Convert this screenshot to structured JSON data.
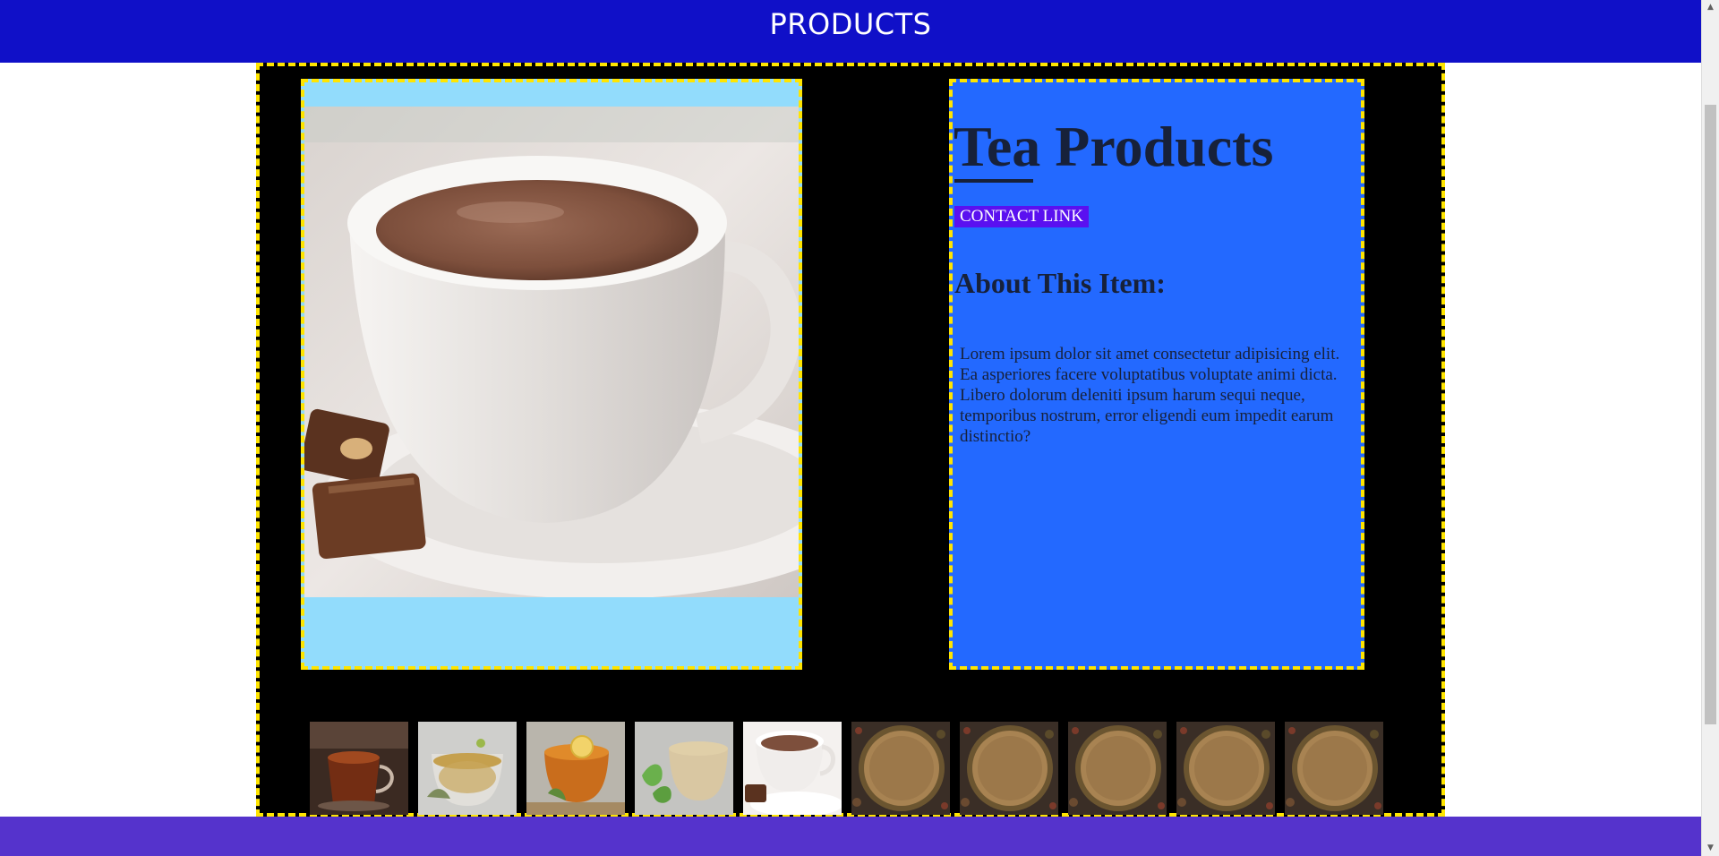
{
  "header": {
    "title": "PRODUCTS"
  },
  "product": {
    "title": "Tea Products",
    "contact_link": "CONTACT LINK",
    "about_heading": "About This Item:",
    "description": "Lorem ipsum dolor sit amet consectetur adipisicing elit. Ea asperiores facere voluptatibus voluptate animi dicta. Libero dolorum deleniti ipsum harum sequi neque, temporibus nostrum, error eligendi eum impedit earum distinctio?"
  },
  "thumbnails": [
    {
      "icon": "black-tea-icon"
    },
    {
      "icon": "herbal-tea-icon"
    },
    {
      "icon": "lemon-tea-icon"
    },
    {
      "icon": "mint-tea-icon"
    },
    {
      "icon": "hot-chocolate-icon"
    },
    {
      "icon": "tea-leaves-icon"
    },
    {
      "icon": "tea-leaves-icon"
    },
    {
      "icon": "tea-leaves-icon"
    },
    {
      "icon": "tea-leaves-icon"
    },
    {
      "icon": "tea-leaves-icon"
    }
  ],
  "colors": {
    "header_bg": "#1010c8",
    "main_bg": "#000000",
    "dashed_border": "#ffe500",
    "image_panel_bg": "#92dcfc",
    "info_panel_bg": "#2369ff",
    "contact_bg": "#5a10f0",
    "footer_bg": "#5533cc",
    "text_dark": "#17213a"
  }
}
